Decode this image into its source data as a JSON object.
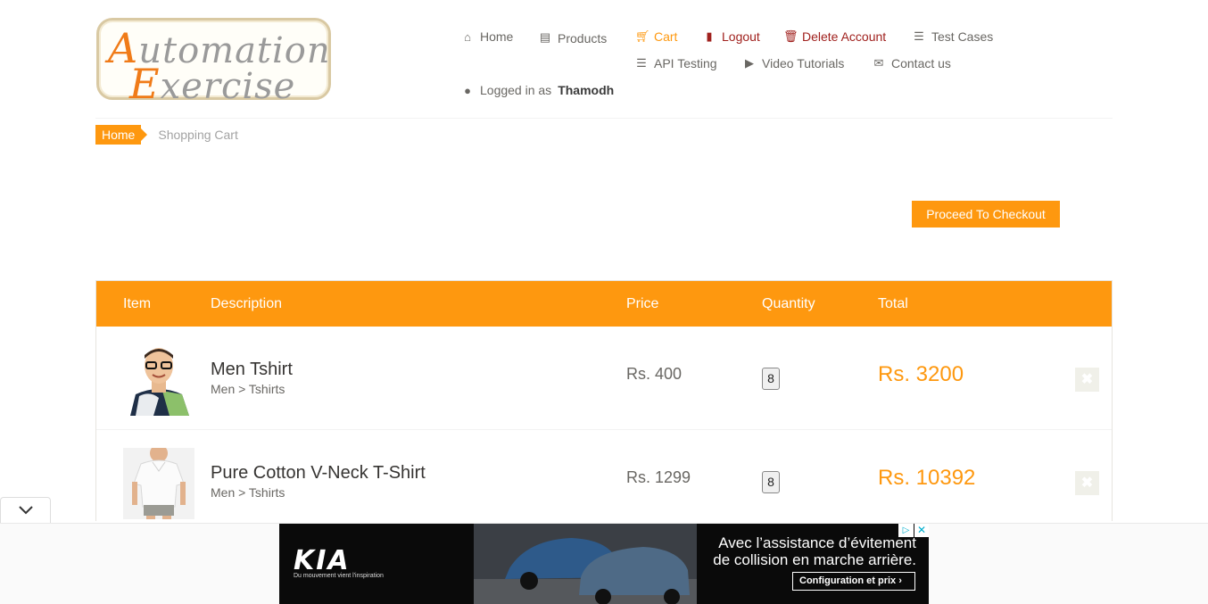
{
  "logo": {
    "line1": "utomation",
    "line1_cap": "A",
    "line2": "xercise",
    "line2_cap": "E"
  },
  "nav": {
    "home": "Home",
    "products": "Products",
    "cart": "Cart",
    "logout": "Logout",
    "delete_account": "Delete Account",
    "test_cases": "Test Cases",
    "api_testing": "API Testing",
    "video_tutorials": "Video Tutorials",
    "contact_us": "Contact us",
    "logged_in_prefix": "Logged in as",
    "username": "Thamodh"
  },
  "breadcrumb": {
    "home": "Home",
    "current": "Shopping Cart"
  },
  "checkout_label": "Proceed To Checkout",
  "table": {
    "headers": [
      "Item",
      "Description",
      "Price",
      "Quantity",
      "Total"
    ],
    "rows": [
      {
        "name": "Men Tshirt",
        "category": "Men > Tshirts",
        "price": "Rs. 400",
        "quantity": "8",
        "total": "Rs. 3200"
      },
      {
        "name": "Pure Cotton V-Neck T-Shirt",
        "category": "Men > Tshirts",
        "price": "Rs. 1299",
        "quantity": "8",
        "total": "Rs. 10392"
      }
    ]
  },
  "ad": {
    "brand": "KIA",
    "tagline": "Du mouvement vient l'inspiration",
    "headline": "Avec l’assistance d’évitement de collision en marche arrière.",
    "cta": "Configuration et prix  ›"
  },
  "colors": {
    "accent": "#fe980f",
    "danger": "#a0211e",
    "text": "#696763"
  }
}
